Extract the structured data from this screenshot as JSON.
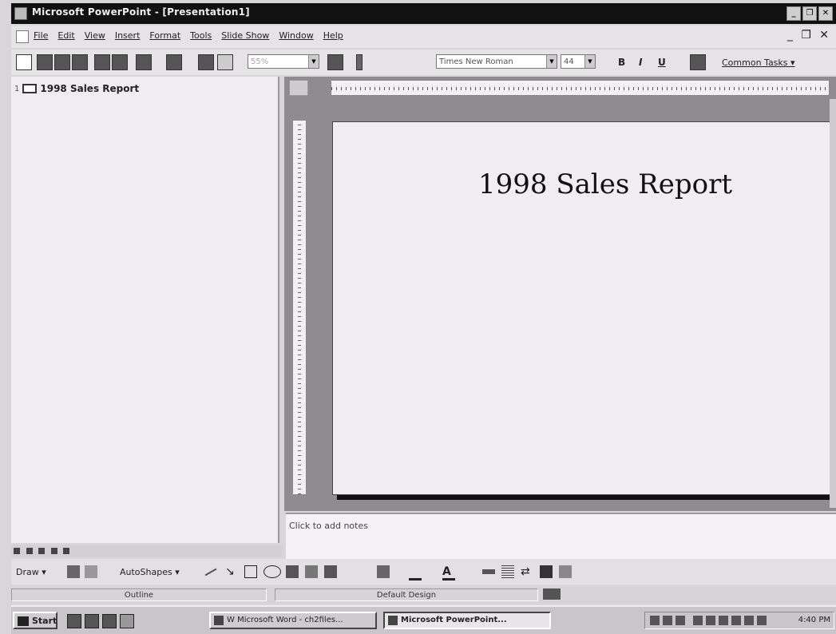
{
  "window": {
    "title": "Microsoft PowerPoint - [Presentation1]",
    "controls": [
      "_",
      "❐",
      "✕"
    ]
  },
  "menu": {
    "items": [
      "File",
      "Edit",
      "View",
      "Insert",
      "Format",
      "Tools",
      "Slide Show",
      "Window",
      "Help"
    ],
    "doc_controls": "_ ❐ ✕"
  },
  "toolbar": {
    "zoom": "55%",
    "font_name": "Times New Roman",
    "font_size": "44",
    "bold": "B",
    "italic": "I",
    "underline": "U",
    "common_tasks": "Common Tasks ▾"
  },
  "outline": {
    "item_number": "1",
    "item_title": "1998 Sales Report"
  },
  "slide": {
    "title": "1998 Sales Report"
  },
  "notes": {
    "placeholder": "Click to add notes"
  },
  "drawing": {
    "draw_label": "Draw ▾",
    "autoshapes_label": "AutoShapes ▾"
  },
  "status": {
    "pane1": "Outline",
    "pane2": "Default Design"
  },
  "taskbar": {
    "start_label": "Start",
    "task_word": "W Microsoft Word - ch2files...",
    "task_ppt": "Microsoft PowerPoint...",
    "clock": "4:40 PM"
  }
}
